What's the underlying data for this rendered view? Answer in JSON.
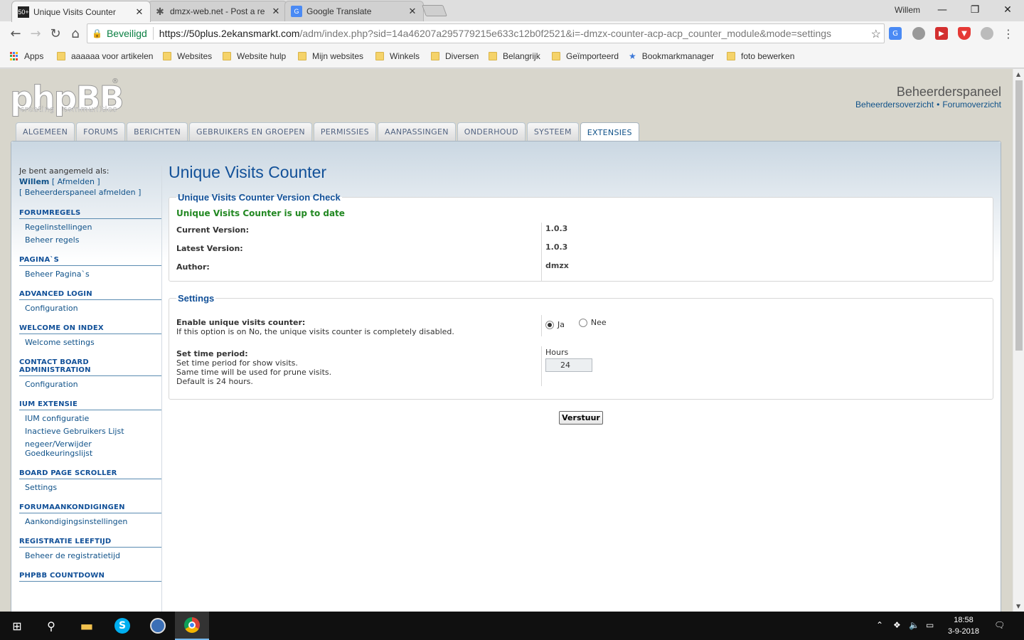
{
  "browser": {
    "tabs": [
      {
        "title": "Unique Visits Counter",
        "favicon": "50plus-site-icon",
        "active": true
      },
      {
        "title": "dmzx-web.net - Post a re",
        "favicon": "loading-spinner-icon",
        "active": false
      },
      {
        "title": "Google Translate",
        "favicon": "google-translate-icon",
        "active": false
      }
    ],
    "user": "Willem",
    "secure_label": "Beveiligd",
    "url_host": "https://50plus.2ekansmarkt.com",
    "url_rest": "/adm/index.php?sid=14a46207a295779215e633c12b0f2521&i=-dmzx-counter-acp-acp_counter_module&mode=settings",
    "bookmarks": [
      "Apps",
      "aaaaaa voor artikelen",
      "Websites",
      "Website hulp",
      "Mijn websites",
      "Winkels",
      "Diversen",
      "Belangrijk",
      "Geïmporteerd",
      "Bookmarkmanager",
      "foto bewerken"
    ]
  },
  "header": {
    "logo_text": "phpBB",
    "logo_reg": "®",
    "logo_sub_left": "creating",
    "logo_sub_right": "communities",
    "acp_title": "Beheerderspaneel",
    "link_overview": "Beheerdersoverzicht",
    "link_separator": "•",
    "link_forum": "Forumoverzicht"
  },
  "tabs": [
    "ALGEMEEN",
    "FORUMS",
    "BERICHTEN",
    "GEBRUIKERS EN GROEPEN",
    "PERMISSIES",
    "AANPASSINGEN",
    "ONDERHOUD",
    "SYSTEEM",
    "EXTENSIES"
  ],
  "sidebar": {
    "logged_in_as": "Je bent aangemeld als:",
    "username": "Willem",
    "logout_label": "[ Afmelden ]",
    "acp_logout_label": "[ Beheerderspaneel afmelden ]",
    "sections": [
      {
        "head": "FORUMREGELS",
        "items": [
          "Regelinstellingen",
          "Beheer regels"
        ]
      },
      {
        "head": "PAGINA`S",
        "items": [
          "Beheer Pagina`s"
        ]
      },
      {
        "head": "ADVANCED LOGIN",
        "items": [
          "Configuration"
        ]
      },
      {
        "head": "WELCOME ON INDEX",
        "items": [
          "Welcome settings"
        ]
      },
      {
        "head": "CONTACT BOARD ADMINISTRATION",
        "items": [
          "Configuration"
        ]
      },
      {
        "head": "IUM EXTENSIE",
        "items": [
          "IUM configuratie",
          "Inactieve Gebruikers Lijst",
          "negeer/Verwijder Goedkeuringslijst"
        ]
      },
      {
        "head": "BOARD PAGE SCROLLER",
        "items": [
          "Settings"
        ]
      },
      {
        "head": "FORUMAANKONDIGINGEN",
        "items": [
          "Aankondigingsinstellingen"
        ]
      },
      {
        "head": "REGISTRATIE LEEFTIJD",
        "items": [
          "Beheer de registratietijd"
        ]
      },
      {
        "head": "PHPBB COUNTDOWN",
        "items": []
      }
    ]
  },
  "main": {
    "title": "Unique Visits Counter",
    "version_check": {
      "legend": "Unique Visits Counter Version Check",
      "status": "Unique Visits Counter is up to date",
      "current_label": "Current Version:",
      "current_value": "1.0.3",
      "latest_label": "Latest Version:",
      "latest_value": "1.0.3",
      "author_label": "Author:",
      "author_value": "dmzx"
    },
    "settings": {
      "legend": "Settings",
      "enable_label": "Enable unique visits counter:",
      "enable_explain": "If this option is on No, the unique visits counter is completely disabled.",
      "yes_label": "Ja",
      "no_label": "Nee",
      "enabled": true,
      "period_label": "Set time period:",
      "period_explain_1": "Set time period for show visits.",
      "period_explain_2": "Same time will be used for prune visits.",
      "period_explain_3": "Default is 24 hours.",
      "hours_label": "Hours",
      "hours_value": "24"
    },
    "submit_label": "Verstuur"
  },
  "taskbar": {
    "time": "18:58",
    "date": "3-9-2018"
  },
  "colors": {
    "link": "#105289",
    "heading": "#115098",
    "success": "#228822"
  }
}
